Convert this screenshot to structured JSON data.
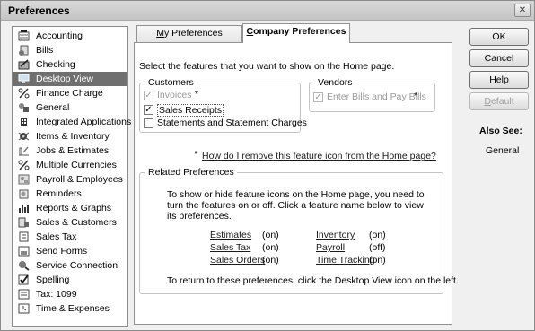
{
  "window": {
    "title": "Preferences",
    "close_label": "✕"
  },
  "sidebar": {
    "items": [
      {
        "label": "Accounting",
        "icon": "ledger-icon"
      },
      {
        "label": "Bills",
        "icon": "bills-icon"
      },
      {
        "label": "Checking",
        "icon": "checkbook-icon"
      },
      {
        "label": "Desktop View",
        "icon": "monitor-icon",
        "selected": true
      },
      {
        "label": "Finance Charge",
        "icon": "percent-icon"
      },
      {
        "label": "General",
        "icon": "general-icon"
      },
      {
        "label": "Integrated Applications",
        "icon": "building-icon"
      },
      {
        "label": "Items & Inventory",
        "icon": "items-icon"
      },
      {
        "label": "Jobs & Estimates",
        "icon": "jobs-icon"
      },
      {
        "label": "Multiple Currencies",
        "icon": "currency-icon"
      },
      {
        "label": "Payroll & Employees",
        "icon": "payroll-icon"
      },
      {
        "label": "Reminders",
        "icon": "reminders-icon"
      },
      {
        "label": "Reports & Graphs",
        "icon": "reports-icon"
      },
      {
        "label": "Sales & Customers",
        "icon": "sales-icon"
      },
      {
        "label": "Sales Tax",
        "icon": "sales-tax-icon"
      },
      {
        "label": "Send Forms",
        "icon": "send-forms-icon"
      },
      {
        "label": "Service Connection",
        "icon": "connection-icon"
      },
      {
        "label": "Spelling",
        "icon": "spelling-icon"
      },
      {
        "label": "Tax: 1099",
        "icon": "tax-icon"
      },
      {
        "label": "Time & Expenses",
        "icon": "time-icon"
      }
    ]
  },
  "tabs": {
    "my_prefix": "M",
    "my_rest": "y Preferences",
    "company_prefix": "C",
    "company_rest": "ompany Preferences",
    "active": "Company Preferences"
  },
  "content": {
    "intro": "Select the features that you want to show on the Home page.",
    "customers": {
      "title": "Customers",
      "options": [
        {
          "label": "Invoices",
          "checked": true,
          "disabled": true,
          "asterisk": "*"
        },
        {
          "label": "Sales Receipts",
          "checked": true,
          "disabled": false,
          "asterisk": ""
        },
        {
          "label": "Statements and Statement Charges",
          "checked": false,
          "disabled": false,
          "asterisk": ""
        }
      ]
    },
    "vendors": {
      "title": "Vendors",
      "options": [
        {
          "label": "Enter Bills and Pay Bills",
          "checked": true,
          "disabled": true,
          "asterisk": "*"
        }
      ]
    },
    "remove_help": {
      "asterisk": "*",
      "link": "How do I remove this feature icon from the Home page?"
    },
    "related": {
      "title": "Related Preferences",
      "description_lines": [
        "To show or hide feature icons on the Home page, you need to",
        "turn the features on or off. Click a feature name below to view",
        "its preferences."
      ],
      "features": [
        {
          "name": "Estimates",
          "status": "(on)"
        },
        {
          "name": "Sales Tax",
          "status": "(on)"
        },
        {
          "name": "Sales Orders",
          "status": "(on)"
        },
        {
          "name": "Inventory",
          "status": "(on)"
        },
        {
          "name": "Payroll",
          "status": "(off)"
        },
        {
          "name": "Time Tracking",
          "status": "(on)"
        }
      ],
      "footer": "To return to these preferences, click the Desktop View icon on the left."
    }
  },
  "buttons": {
    "ok": "OK",
    "cancel": "Cancel",
    "help": "Help",
    "default_prefix": "D",
    "default_rest": "efault"
  },
  "also_see": {
    "title": "Also See:",
    "link": "General"
  }
}
